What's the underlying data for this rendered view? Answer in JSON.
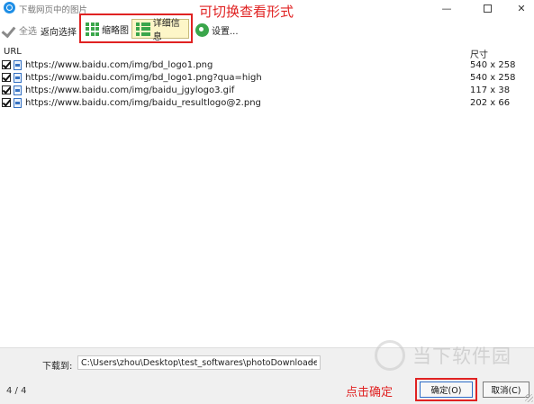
{
  "window": {
    "title": "下载网页中的图片",
    "minimize_glyph": "—",
    "close_glyph": "✕"
  },
  "toolbar": {
    "select_all": "全选",
    "invert_select": "返向选择",
    "thumbnail": "缩略图",
    "details": "详细信息",
    "settings": "设置...",
    "annotation": "可切换查看形式"
  },
  "list": {
    "col_url": "URL",
    "col_size": "尺寸",
    "rows": [
      {
        "url": "https://www.baidu.com/img/bd_logo1.png",
        "size": "540 x 258",
        "checked": true
      },
      {
        "url": "https://www.baidu.com/img/bd_logo1.png?qua=high",
        "size": "540 x 258",
        "checked": true
      },
      {
        "url": "https://www.baidu.com/img/baidu_jgylogo3.gif",
        "size": "117 x 38",
        "checked": true
      },
      {
        "url": "https://www.baidu.com/img/baidu_resultlogo@2.png",
        "size": "202 x 66",
        "checked": true
      }
    ]
  },
  "footer": {
    "download_to_label": "下载到:",
    "download_path": "C:\\Users\\zhou\\Desktop\\test_softwares\\photoDownloader",
    "browse": "...",
    "count": "4 / 4",
    "hint": "点击确定",
    "ok": "确定(O)",
    "cancel": "取消(C)"
  },
  "watermark": "当下软件园",
  "colors": {
    "accent_red": "#e02222",
    "icon_green": "#3aa64b",
    "app_blue": "#1e8ee6",
    "detail_highlight": "#fdf6c8"
  }
}
